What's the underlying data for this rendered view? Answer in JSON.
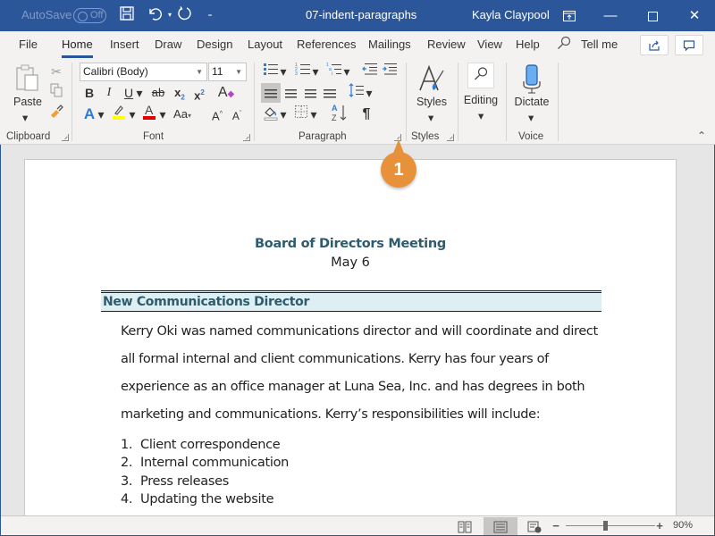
{
  "titlebar": {
    "autosave_label": "AutoSave",
    "autosave_state": "Off",
    "doc_title": "07-indent-paragraphs",
    "user_name": "Kayla Claypool",
    "icons": [
      "save-icon",
      "undo-icon",
      "redo-icon",
      "customize-qat-icon",
      "ribbon-display-icon",
      "minimize-icon",
      "maximize-icon",
      "close-icon"
    ]
  },
  "tabs": [
    {
      "label": "File"
    },
    {
      "label": "Home",
      "active": true
    },
    {
      "label": "Insert"
    },
    {
      "label": "Draw"
    },
    {
      "label": "Design"
    },
    {
      "label": "Layout"
    },
    {
      "label": "References"
    },
    {
      "label": "Mailings"
    },
    {
      "label": "Review"
    },
    {
      "label": "View"
    },
    {
      "label": "Help"
    }
  ],
  "tell_me": "Tell me",
  "ribbon": {
    "clipboard": {
      "label": "Clipboard",
      "paste_label": "Paste"
    },
    "font": {
      "label": "Font",
      "font_name": "Calibri (Body)",
      "font_size": "11",
      "highlight_color": "#ffff00",
      "font_color": "#e00000",
      "change_case_label": "Aa"
    },
    "paragraph": {
      "label": "Paragraph"
    },
    "styles": {
      "label": "Styles",
      "button_label": "Styles"
    },
    "editing": {
      "button_label": "Editing"
    },
    "voice": {
      "label": "Voice",
      "button_label": "Dictate"
    }
  },
  "callout": {
    "number": "1",
    "color": "#e8913b"
  },
  "document": {
    "title": "Board of Directors Meeting",
    "date": "May 6",
    "section_heading": "New Communications Director",
    "paragraph_lines": [
      "Kerry Oki was named communications director and will coordinate and direct",
      "all formal internal and client communications. Kerry has four years of",
      "experience as an office manager at Luna Sea, Inc. and has degrees in both",
      "marketing and communications. Kerry’s responsibilities will include:"
    ],
    "list": [
      {
        "num": "1.",
        "text": "Client correspondence"
      },
      {
        "num": "2.",
        "text": "Internal communication"
      },
      {
        "num": "3.",
        "text": "Press releases"
      },
      {
        "num": "4.",
        "text": "Updating the website"
      }
    ]
  },
  "statusbar": {
    "zoom_label": "90%",
    "zoom_percent": 90,
    "active_view": "print-layout"
  },
  "colors": {
    "brand": "#2b579a",
    "heading": "#2e5c6e",
    "section_shading": "#ddeff3"
  }
}
